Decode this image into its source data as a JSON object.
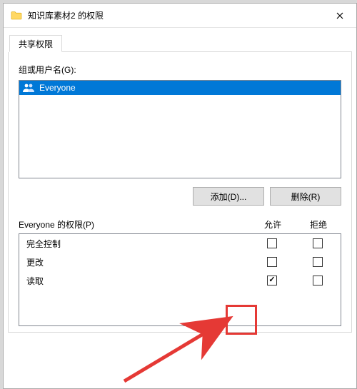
{
  "title": "知识库素材2 的权限",
  "tabs": {
    "share": "共享权限"
  },
  "users": {
    "label": "组或用户名(G):",
    "list": [
      {
        "name": "Everyone",
        "icon": "group-icon"
      }
    ]
  },
  "buttons": {
    "add": "添加(D)...",
    "remove": "删除(R)"
  },
  "perms": {
    "label": "Everyone 的权限(P)",
    "cols": {
      "allow": "允许",
      "deny": "拒绝"
    },
    "rows": [
      {
        "name": "完全控制",
        "allow": false,
        "deny": false
      },
      {
        "name": "更改",
        "allow": false,
        "deny": false
      },
      {
        "name": "读取",
        "allow": true,
        "deny": false
      }
    ]
  }
}
